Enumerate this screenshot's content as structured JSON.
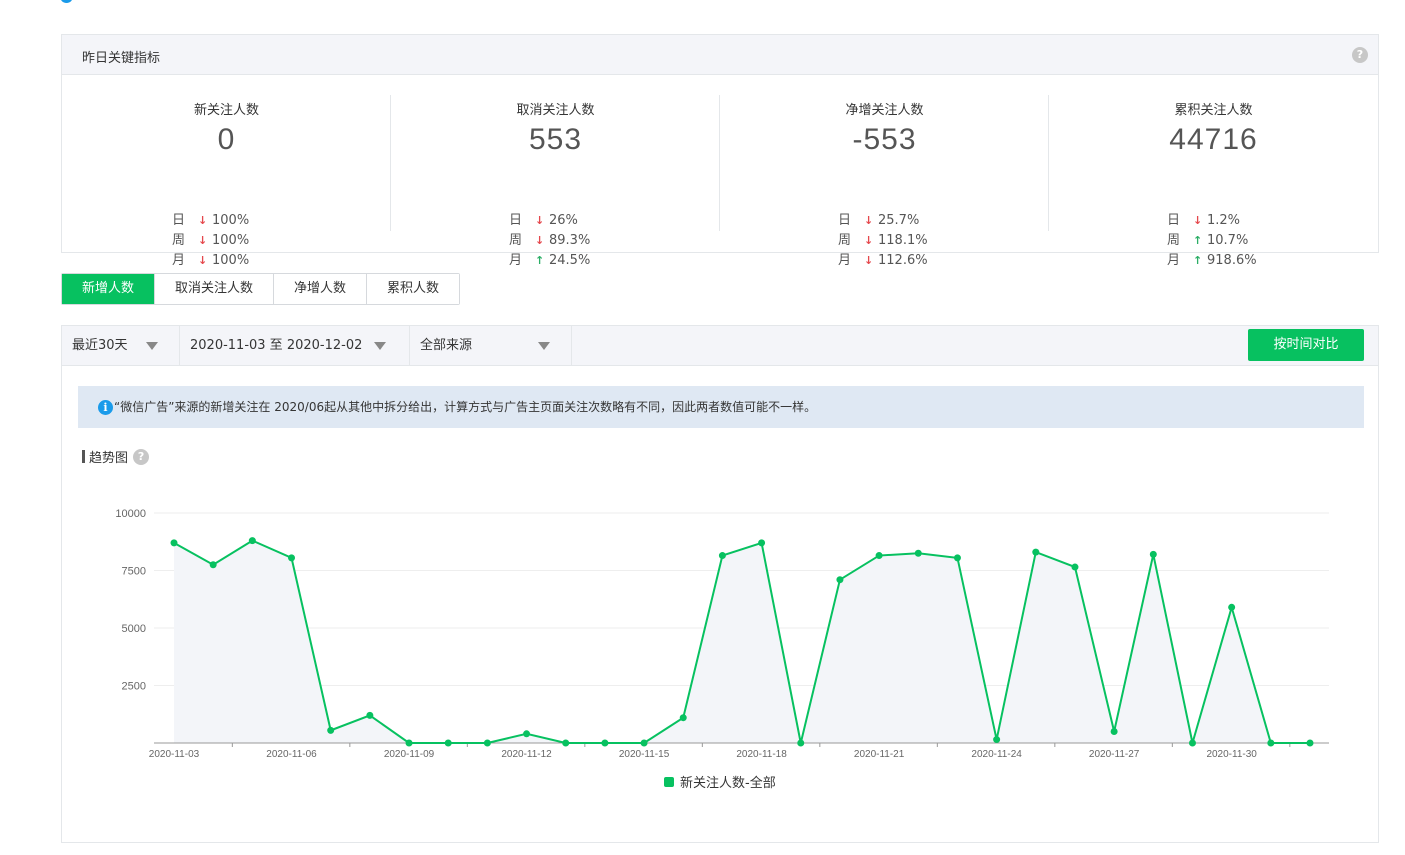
{
  "kpi": {
    "title": "昨日关键指标",
    "help": "?",
    "cards": [
      {
        "label": "新关注人数",
        "value": "0",
        "trends": [
          {
            "label": "日",
            "dir": "down",
            "value": "100%"
          },
          {
            "label": "周",
            "dir": "down",
            "value": "100%"
          },
          {
            "label": "月",
            "dir": "down",
            "value": "100%"
          }
        ]
      },
      {
        "label": "取消关注人数",
        "value": "553",
        "trends": [
          {
            "label": "日",
            "dir": "down",
            "value": "26%"
          },
          {
            "label": "周",
            "dir": "down",
            "value": "89.3%"
          },
          {
            "label": "月",
            "dir": "up",
            "value": "24.5%"
          }
        ]
      },
      {
        "label": "净增关注人数",
        "value": "-553",
        "trends": [
          {
            "label": "日",
            "dir": "down",
            "value": "25.7%"
          },
          {
            "label": "周",
            "dir": "down",
            "value": "118.1%"
          },
          {
            "label": "月",
            "dir": "down",
            "value": "112.6%"
          }
        ]
      },
      {
        "label": "累积关注人数",
        "value": "44716",
        "trends": [
          {
            "label": "日",
            "dir": "down",
            "value": "1.2%"
          },
          {
            "label": "周",
            "dir": "up",
            "value": "10.7%"
          },
          {
            "label": "月",
            "dir": "up",
            "value": "918.6%"
          }
        ]
      }
    ]
  },
  "tabs": [
    {
      "label": "新增人数",
      "active": true
    },
    {
      "label": "取消关注人数",
      "active": false
    },
    {
      "label": "净增人数",
      "active": false
    },
    {
      "label": "累积人数",
      "active": false
    }
  ],
  "filters": {
    "range": "最近30天",
    "dates": "2020-11-03 至 2020-12-02",
    "source": "全部来源",
    "compare_button": "按时间对比"
  },
  "notice": {
    "icon": "i",
    "text": "“微信广告”来源的新增关注在 2020/06起从其他中拆分给出，计算方式与广告主页面关注次数略有不同，因此两者数值可能不一样。"
  },
  "chart_section": {
    "title": "趋势图",
    "help": "?"
  },
  "colors": {
    "accent": "#07c160",
    "down": "#e5484d",
    "up": "#2bae66",
    "info": "#1a9bea"
  },
  "chart_data": {
    "type": "area",
    "title": "",
    "xlabel": "",
    "ylabel": "",
    "ylim": [
      0,
      10000
    ],
    "yticks": [
      2500,
      5000,
      7500,
      10000
    ],
    "x": [
      "2020-11-03",
      "2020-11-04",
      "2020-11-05",
      "2020-11-06",
      "2020-11-07",
      "2020-11-08",
      "2020-11-09",
      "2020-11-10",
      "2020-11-11",
      "2020-11-12",
      "2020-11-13",
      "2020-11-14",
      "2020-11-15",
      "2020-11-16",
      "2020-11-17",
      "2020-11-18",
      "2020-11-19",
      "2020-11-20",
      "2020-11-21",
      "2020-11-22",
      "2020-11-23",
      "2020-11-24",
      "2020-11-25",
      "2020-11-26",
      "2020-11-27",
      "2020-11-28",
      "2020-11-29",
      "2020-11-30",
      "2020-12-01",
      "2020-12-02"
    ],
    "xtick_labels": [
      "2020-11-03",
      "2020-11-06",
      "2020-11-09",
      "2020-11-12",
      "2020-11-15",
      "2020-11-18",
      "2020-11-21",
      "2020-11-24",
      "2020-11-27",
      "2020-11-30"
    ],
    "grid": true,
    "legend": "bottom-center",
    "series": [
      {
        "name": "新关注人数-全部",
        "values": [
          8700,
          7750,
          8800,
          8050,
          550,
          1200,
          0,
          0,
          0,
          400,
          0,
          0,
          0,
          1100,
          8150,
          8700,
          0,
          7100,
          8150,
          8250,
          8050,
          150,
          8300,
          7650,
          500,
          8200,
          0,
          5900,
          0,
          0
        ]
      }
    ]
  }
}
